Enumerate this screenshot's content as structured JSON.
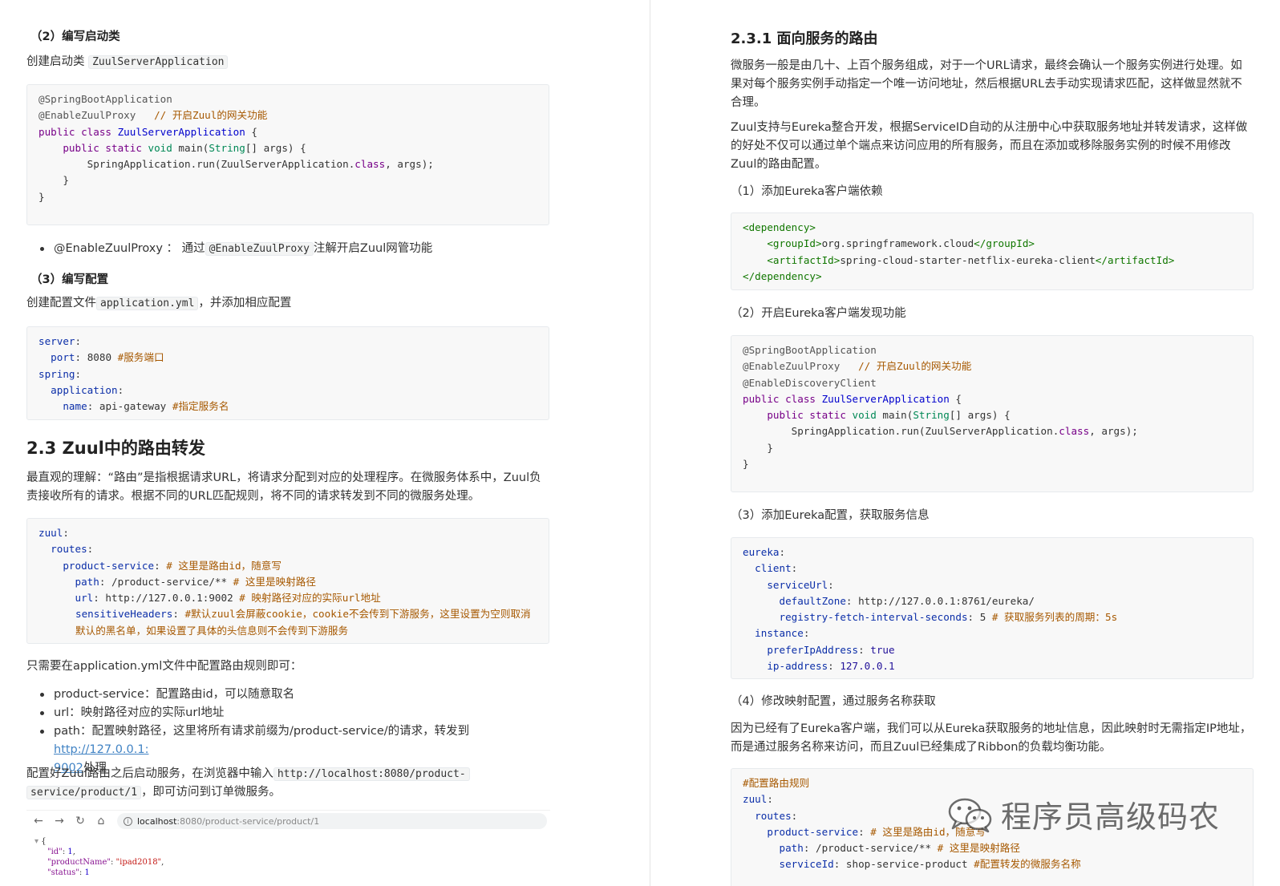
{
  "left": {
    "h_startup": "（2）编写启动类",
    "p_startup_prefix": "创建启动类 ",
    "p_startup_code": "ZuulServerApplication",
    "code1": {
      "l1": "@SpringBootApplication",
      "l2_anno": "@EnableZuulProxy",
      "l2_comment": "// 开启Zuul的网关功能",
      "l3_kw": "public class ",
      "l3_def": "ZuulServerApplication",
      "l3_tail": " {",
      "l4_kw1": "public static ",
      "l4_ty": "void",
      "l4_mid": " main(",
      "l4_ty2": "String",
      "l4_tail": "[] args) {",
      "l5_pre": "SpringApplication.run(ZuulServerApplication.",
      "l5_kw": "class",
      "l5_tail": ", args);",
      "l6": "}",
      "l7": "}"
    },
    "bullet1_a": "@EnableZuulProxy ： 通过",
    "bullet1_code": "@EnableZuulProxy",
    "bullet1_b": "注解开启Zuul网管功能",
    "h_config": "（3）编写配置",
    "p_config_prefix": "创建配置文件",
    "p_config_code": "application.yml",
    "p_config_suffix": "，并添加相应配置",
    "code2": {
      "k1": "server",
      "k2": "port",
      "v2": " 8080 ",
      "c2": "#服务端口",
      "k3": "spring",
      "k4": "application",
      "k5": "name",
      "v5": " api-gateway ",
      "c5": "#指定服务名"
    },
    "h2": "2.3 Zuul中的路由转发",
    "p_route": "最直观的理解：“路由”是指根据请求URL，将请求分配到对应的处理程序。在微服务体系中，Zuul负责接收所有的请求。根据不同的URL匹配规则，将不同的请求转发到不同的微服务处理。",
    "code3": {
      "k1": "zuul",
      "k2": "routes",
      "k3": "product-service",
      "c3": "# 这里是路由id，随意写",
      "k4": "path",
      "v4": " /product-service/** ",
      "c4": "# 这里是映射路径",
      "k5": "url",
      "v5": " http://127.0.0.1:9002 ",
      "c5": "# 映射路径对应的实际url地址",
      "k6": "sensitiveHeaders",
      "c6": "#默认zuul会屏蔽cookie，cookie不会传到下游服务，这里设置为空则取消默认的黑名单，如果设置了具体的头信息则不会传到下游服务"
    },
    "p_only": "只需要在application.yml文件中配置路由规则即可：",
    "list": {
      "b1": "product-service：配置路由id，可以随意取名",
      "b2": "url：映射路径对应的实际url地址",
      "b3_a": "path：配置映射路径，这里将所有请求前缀为/product-service/的请求，转发到",
      "b3_link1": "http://127.0.0.1:",
      "b3_link2": "9002",
      "b3_b": "处理"
    },
    "p_after_1": "配置好Zuul路由之后启动服务，在浏览器中输入",
    "p_after_code1": "http://localhost:8080/product-",
    "p_after_code2": "service/product/1",
    "p_after_2": "，即可访问到订单微服务。",
    "browser": {
      "back": "←",
      "forward": "→",
      "reload": "↻",
      "home": "⌂",
      "info": "i",
      "host": "localhost",
      "path": ":8080/product-service/product/1",
      "j1": "{",
      "j2_k": "\"id\"",
      "j2_v": "1",
      "j3_k": "\"productName\"",
      "j3_v": "\"ipad2018\"",
      "j4_k": "\"status\"",
      "j4_v": "1"
    }
  },
  "right": {
    "h3": "2.3.1 面向服务的路由",
    "p1": "微服务一般是由几十、上百个服务组成，对于一个URL请求，最终会确认一个服务实例进行处理。如果对每个服务实例手动指定一个唯一访问地址，然后根据URL去手动实现请求匹配，这样做显然就不合理。",
    "p2": "Zuul支持与Eureka整合开发，根据ServiceID自动的从注册中心中获取服务地址并转发请求，这样做的好处不仅可以通过单个端点来访问应用的所有服务，而且在添加或移除服务实例的时候不用修改Zuul的路由配置。",
    "step1": "（1）添加Eureka客户端依赖",
    "code4": {
      "o1": "<dependency>",
      "o2": "<groupId>",
      "v2": "org.springframework.cloud",
      "e2": "</groupId>",
      "o3": "<artifactId>",
      "v3": "spring-cloud-starter-netflix-eureka-client",
      "e3": "</artifactId>",
      "e1": "</dependency>"
    },
    "step2": "（2）开启Eureka客户端发现功能",
    "code5": {
      "l1": "@SpringBootApplication",
      "l2_anno": "@EnableZuulProxy",
      "l2_comment": "// 开启Zuul的网关功能",
      "l3": "@EnableDiscoveryClient",
      "l4_kw": "public class ",
      "l4_def": "ZuulServerApplication",
      "l4_tail": " {",
      "l5_kw": "public static ",
      "l5_ty": "void",
      "l5_mid": " main(",
      "l5_ty2": "String",
      "l5_tail": "[] args) {",
      "l6_pre": "SpringApplication.run(ZuulServerApplication.",
      "l6_kw": "class",
      "l6_tail": ", args);",
      "l7": "}",
      "l8": "}"
    },
    "step3": "（3）添加Eureka配置，获取服务信息",
    "code6": {
      "k1": "eureka",
      "k2": "client",
      "k3": "serviceUrl",
      "k4": "defaultZone",
      "v4": " http://127.0.0.1:8761/eureka/",
      "k5": "registry-fetch-interval-seconds",
      "v5": " 5 ",
      "c5": "# 获取服务列表的周期：5s",
      "k6": "instance",
      "k7": "preferIpAddress",
      "v7": "true",
      "k8": "ip-address",
      "v8": "127.0.0.1"
    },
    "step4": "（4）修改映射配置，通过服务名称获取",
    "p3": "因为已经有了Eureka客户端，我们可以从Eureka获取服务的地址信息，因此映射时无需指定IP地址，而是通过服务名称来访问，而且Zuul已经集成了Ribbon的负载均衡功能。",
    "code7": {
      "c1": "#配置路由规则",
      "k2": "zuul",
      "k3": "routes",
      "k4": "product-service",
      "c4": "# 这里是路由id，随意写",
      "k5": "path",
      "v5": " /product-service/** ",
      "c5": "# 这里是映射路径",
      "k6": "serviceId",
      "v6": " shop-service-product ",
      "c6": "#配置转发的微服务名称"
    },
    "watermark": "程序员高级码农"
  }
}
